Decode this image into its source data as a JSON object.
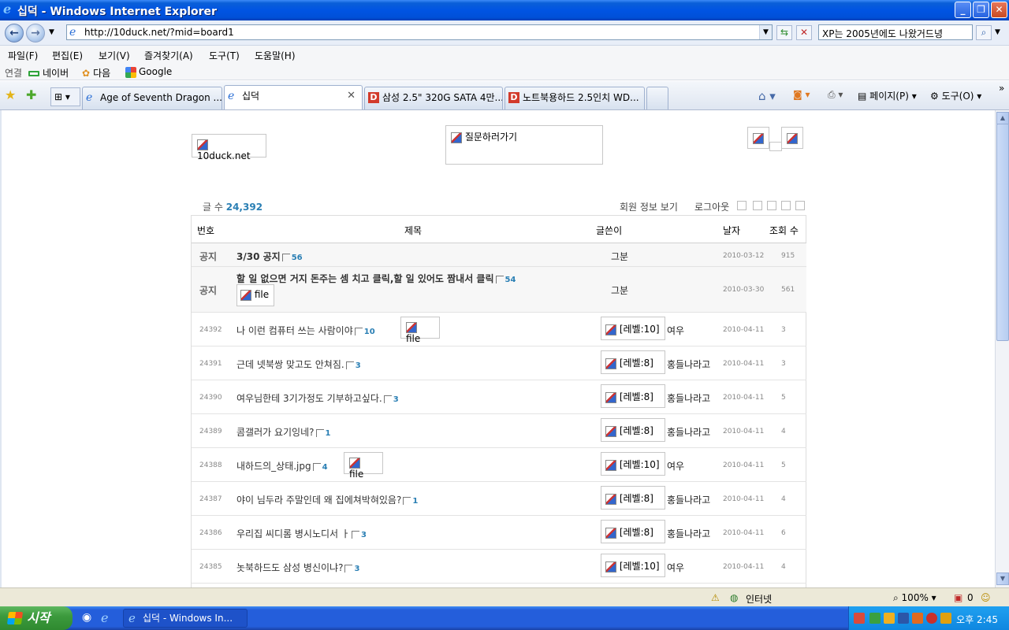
{
  "window": {
    "title": "십덕 - Windows Internet Explorer"
  },
  "address": {
    "url": "http://10duck.net/?mid=board1",
    "search_value": "XP는 2005년에도 나왔거드녕"
  },
  "menu": [
    "파일(F)",
    "편집(E)",
    "보기(V)",
    "즐겨찾기(A)",
    "도구(T)",
    "도움말(H)"
  ],
  "links": {
    "label": "연결",
    "items": [
      "네이버",
      "다음",
      "Google"
    ]
  },
  "tabs": [
    {
      "label": "Age of Seventh Dragon ...",
      "icon": "ie-icon",
      "active": false
    },
    {
      "label": "십덕",
      "icon": "ie-icon",
      "active": true
    },
    {
      "label": "삼성 2.5\" 320G SATA 4만...",
      "icon": "d-icon",
      "active": false
    },
    {
      "label": "노트북용하드 2.5인치 WD...",
      "icon": "d-icon",
      "active": false
    }
  ],
  "toolbar": {
    "page": "페이지(P)",
    "tools": "도구(O)"
  },
  "site": {
    "logo": "10duck.net",
    "ask_link": "질문하러가기",
    "post_count_label": "글 수",
    "post_count": "24,392",
    "member_info": "회원 정보 보기",
    "logout": "로그아웃"
  },
  "board": {
    "columns": [
      "번호",
      "제목",
      "글쓴이",
      "날자",
      "조회 수"
    ],
    "notices": [
      {
        "num": "공지",
        "title": "3/30 공지",
        "comments": "56",
        "author": "그분",
        "date": "2010-03-12",
        "views": "915"
      },
      {
        "num": "공지",
        "title": "할 일 없으면 거지 돈주는 셈 치고 클릭,할 일 있어도 짬내서 클릭",
        "comments": "54",
        "file": "file",
        "author": "그분",
        "date": "2010-03-30",
        "views": "561"
      }
    ],
    "rows": [
      {
        "num": "24392",
        "title": "나 이런 컴퓨터 쓰는 사람이야",
        "comments": "10",
        "file": "file",
        "level": "[레벨:10]",
        "author": "여우",
        "date": "2010-04-11",
        "views": "3"
      },
      {
        "num": "24391",
        "title": "근데 넷북쌍 맞고도 안쳐짐.",
        "comments": "3",
        "level": "[레벨:8]",
        "author": "홍들나라고",
        "date": "2010-04-11",
        "views": "3"
      },
      {
        "num": "24390",
        "title": "여우님한테 3기가정도 기부하고싶다.",
        "comments": "3",
        "level": "[레벨:8]",
        "author": "홍들나라고",
        "date": "2010-04-11",
        "views": "5"
      },
      {
        "num": "24389",
        "title": "콤갤러가 요기잉네?",
        "comments": "1",
        "level": "[레벨:8]",
        "author": "홍들나라고",
        "date": "2010-04-11",
        "views": "4"
      },
      {
        "num": "24388",
        "title": "내하드의_상태.jpg",
        "comments": "4",
        "file": "file",
        "level": "[레벨:10]",
        "author": "여우",
        "date": "2010-04-11",
        "views": "5"
      },
      {
        "num": "24387",
        "title": "야이 님두라 주말인데 왜 집에쳐박혀있음?",
        "comments": "1",
        "level": "[레벨:8]",
        "author": "홍들나라고",
        "date": "2010-04-11",
        "views": "4"
      },
      {
        "num": "24386",
        "title": "우리집 씨디롬 병시노디서 ㅏ",
        "comments": "3",
        "level": "[레벨:8]",
        "author": "홍들나라고",
        "date": "2010-04-11",
        "views": "6"
      },
      {
        "num": "24385",
        "title": "놋북하드도 삼성 병신이냐?",
        "comments": "3",
        "level": "[레벨:10]",
        "author": "여우",
        "date": "2010-04-11",
        "views": "4"
      }
    ]
  },
  "status": {
    "zone": "인터넷",
    "zoom": "100%",
    "count": "0"
  },
  "taskbar": {
    "start": "시작",
    "task": "십덕 - Windows In...",
    "clock": "오후 2:45"
  }
}
